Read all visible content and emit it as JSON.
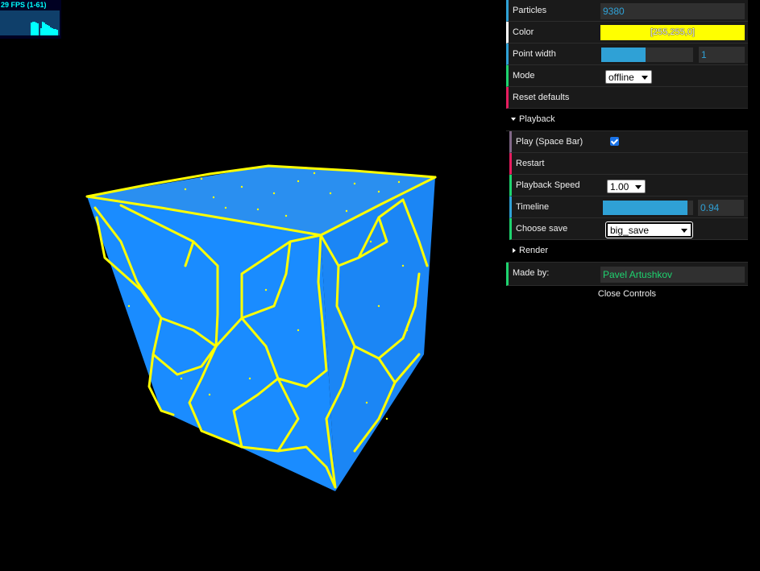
{
  "stats": {
    "fps_text": "29 FPS (1-61)",
    "accent": "#00ffff"
  },
  "gui": {
    "particles": {
      "label": "Particles",
      "value": "9380"
    },
    "color": {
      "label": "Color",
      "value": "[255,255,0]",
      "hex": "#ffff00"
    },
    "point_width": {
      "label": "Point width",
      "value": "1",
      "fill_fraction": 0.48
    },
    "mode": {
      "label": "Mode",
      "selected": "offline"
    },
    "reset": {
      "label": "Reset defaults"
    },
    "playback": {
      "title": "Playback",
      "play": {
        "label": "Play (Space Bar)",
        "checked": true
      },
      "restart": {
        "label": "Restart"
      },
      "speed": {
        "label": "Playback Speed",
        "selected": "1.00"
      },
      "timeline": {
        "label": "Timeline",
        "value": "0.94",
        "fill_fraction": 0.94
      },
      "save": {
        "label": "Choose save",
        "selected": "big_save"
      }
    },
    "render": {
      "title": "Render"
    },
    "made_by": {
      "label": "Made by:",
      "value": "Pavel Artushkov"
    },
    "close": "Close Controls"
  },
  "scene": {
    "cube_color": "#1a8cff",
    "particle_color": "#ffff00",
    "background": "#000000"
  }
}
